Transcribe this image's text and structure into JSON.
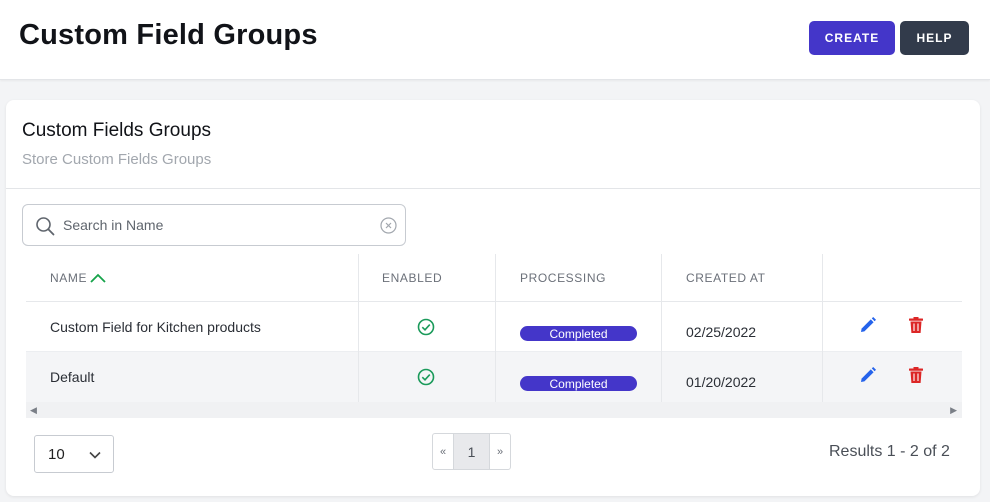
{
  "header": {
    "title": "Custom Field Groups",
    "create_label": "CREATE",
    "help_label": "HELP"
  },
  "card": {
    "title": "Custom Fields Groups",
    "subtitle": "Store Custom Fields Groups"
  },
  "search": {
    "placeholder": "Search in Name",
    "value": ""
  },
  "table": {
    "columns": [
      "NAME",
      "ENABLED",
      "PROCESSING",
      "CREATED AT",
      ""
    ],
    "sort": {
      "column": "NAME",
      "direction": "ascending"
    },
    "rows": [
      {
        "name": "Custom Field for Kitchen products",
        "enabled": true,
        "processing": "Completed",
        "created_at": "02/25/2022"
      },
      {
        "name": "Default",
        "enabled": true,
        "processing": "Completed",
        "created_at": "01/20/2022"
      }
    ]
  },
  "pagination": {
    "per_page": "10",
    "prev_label": "«",
    "current_page": "1",
    "next_label": "»",
    "results_text": "Results 1 - 2 of 2"
  },
  "icons": {
    "search": "search-icon",
    "clear": "clear-icon",
    "sort": "chevron-up-icon",
    "enabled": "check-circle-icon",
    "edit": "pencil-icon",
    "delete": "trash-icon",
    "per_page": "chevron-down-icon"
  },
  "colors": {
    "primary": "#4436c9",
    "help_button": "#323b4b",
    "success": "#1a9a5a",
    "edit": "#2563eb",
    "delete": "#dc2626",
    "sort_indicator": "#16a34a"
  }
}
